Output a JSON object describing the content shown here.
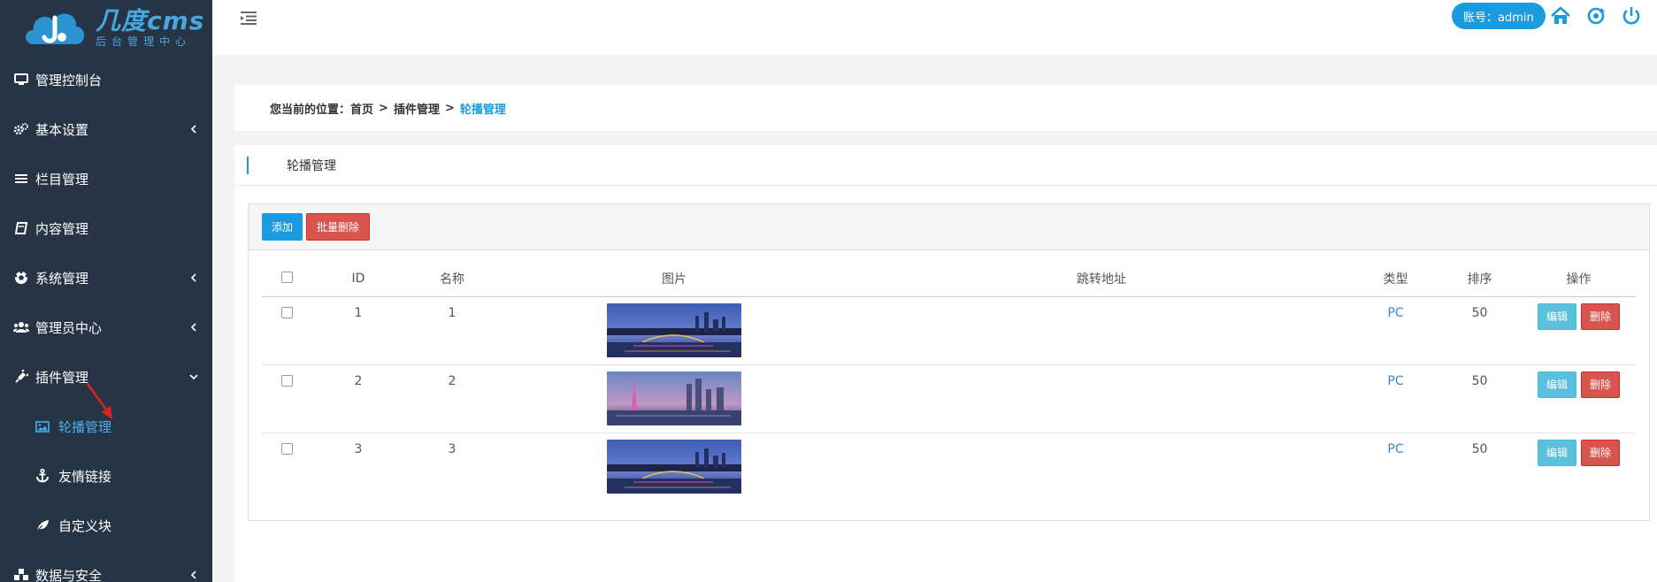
{
  "logo": {
    "main": "几度cms",
    "sub": "后台管理中心"
  },
  "sidebar": {
    "items": [
      {
        "label": "管理控制台",
        "icon": "monitor-icon",
        "arrow": ""
      },
      {
        "label": "基本设置",
        "icon": "gears-icon",
        "arrow": "chevron-left-icon"
      },
      {
        "label": "栏目管理",
        "icon": "list-icon",
        "arrow": ""
      },
      {
        "label": "内容管理",
        "icon": "book-icon",
        "arrow": ""
      },
      {
        "label": "系统管理",
        "icon": "soccer-ball-icon",
        "arrow": "chevron-left-icon"
      },
      {
        "label": "管理员中心",
        "icon": "users-icon",
        "arrow": "chevron-left-icon"
      },
      {
        "label": "插件管理",
        "icon": "plug-icon",
        "arrow": "chevron-down-icon"
      }
    ],
    "subitems": [
      {
        "label": "轮播管理",
        "icon": "image-icon",
        "active": true
      },
      {
        "label": "友情链接",
        "icon": "anchor-icon",
        "active": false
      },
      {
        "label": "自定义块",
        "icon": "leaf-icon",
        "active": false
      }
    ],
    "last_item": {
      "label": "数据与安全",
      "icon": "cubes-icon",
      "arrow": "chevron-left-icon"
    }
  },
  "topbar": {
    "account": "账号：admin",
    "icons": [
      "home-icon",
      "refresh-icon",
      "power-icon"
    ]
  },
  "breadcrumb": {
    "prefix": "您当前的位置：",
    "crumbs": [
      "首页",
      "插件管理",
      "轮播管理"
    ],
    "separator": ">"
  },
  "panel": {
    "title": "轮播管理"
  },
  "toolbar": {
    "add_label": "添加",
    "batch_delete_label": "批量删除"
  },
  "table": {
    "headers": [
      "ID",
      "名称",
      "图片",
      "跳转地址",
      "类型",
      "排序",
      "操作"
    ],
    "rows": [
      {
        "id": "1",
        "name": "1",
        "image": "city-night-bridge-photo",
        "url": "",
        "type": "PC",
        "sort": "50",
        "edit": "编辑",
        "delete": "删除"
      },
      {
        "id": "2",
        "name": "2",
        "image": "city-dusk-tower-photo",
        "url": "",
        "type": "PC",
        "sort": "50",
        "edit": "编辑",
        "delete": "删除"
      },
      {
        "id": "3",
        "name": "3",
        "image": "city-night-bridge-photo",
        "url": "",
        "type": "PC",
        "sort": "50",
        "edit": "编辑",
        "delete": "删除"
      }
    ]
  },
  "colors": {
    "sidebar_bg": "#263445",
    "accent": "#1a9be0",
    "danger": "#d9534f",
    "info": "#5bc0de"
  }
}
